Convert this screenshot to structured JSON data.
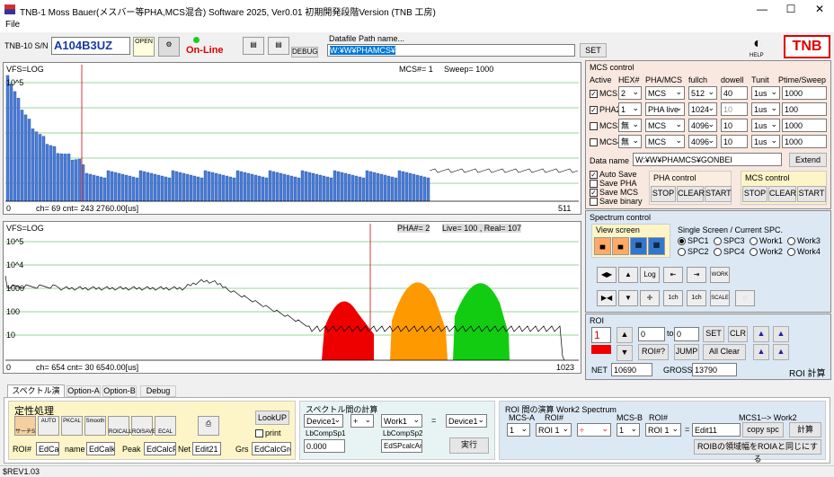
{
  "window": {
    "title": "TNB-1 Moss Bauer(メスバー等PHA,MCS混合) Software 2025,   Ver0.01    初期開発段階Version (TNB  工房)"
  },
  "menu": {
    "file": "File"
  },
  "toolbar": {
    "sn_label": "TNB-10 S/N",
    "sn_value": "A104B3UZ",
    "open_label": "OPEN",
    "online": "On-Line",
    "debug": "DEBUG",
    "datafile_label": "Datafile Path name...",
    "datafile_value": "W:¥W¥PHAMCS¥",
    "set": "SET",
    "help": "HELP",
    "logo": "TNB"
  },
  "top_plot": {
    "scale": "VFS=LOG",
    "decade_label": "10^5",
    "mcs_label": "MCS#= 1",
    "sweep_label": "Sweep=   1000",
    "x_left": "0",
    "x_right": "511",
    "cursor_info": "ch= 69   cnt=    243  2760.00[us]"
  },
  "bottom_plot": {
    "scale": "VFS=LOG",
    "pha_label": "PHA#= 2",
    "live_label": "Live=    100 , Real=    107",
    "y_labels": [
      "10^5",
      "10^4",
      "1000",
      "100",
      "10"
    ],
    "x_left": "0",
    "x_right": "1023",
    "cursor_info": "ch= 654   cnt=    30  6540.00[us]"
  },
  "mcs_control": {
    "title": "MCS control",
    "headers": [
      "Active",
      "HEX#",
      "PHA/MCS",
      "fullch",
      "dowell",
      "Tunit",
      "Ptime/Sweep"
    ],
    "rows": [
      {
        "name": "MCS1",
        "checked": "✓",
        "hex": "2",
        "mode": "MCS",
        "fullch": "512",
        "dowell": "40",
        "tunit": "1us",
        "ptime": "1000"
      },
      {
        "name": "PHA2",
        "checked": "✓",
        "hex": "1",
        "mode": "PHA live",
        "fullch": "1024",
        "dowell": "10",
        "tunit": "1us",
        "ptime": "100"
      },
      {
        "name": "MCS3",
        "checked": "",
        "hex": "無",
        "mode": "MCS",
        "fullch": "4096",
        "dowell": "10",
        "tunit": "1us",
        "ptime": "1000"
      },
      {
        "name": "MCS4",
        "checked": "",
        "hex": "無",
        "mode": "MCS",
        "fullch": "4096",
        "dowell": "10",
        "tunit": "1us",
        "ptime": "1000"
      }
    ],
    "data_name_label": "Data name",
    "data_name_value": "W:¥W¥PHAMCS¥GONBEI",
    "extend": "Extend",
    "auto_save": "Auto Save",
    "save_pha": "Save PHA",
    "save_mcs": "Save MCS",
    "save_binary": "Save binary",
    "pha_control": "PHA control",
    "mcs_control2": "MCS control",
    "stop": "STOP",
    "clear": "CLEAR",
    "start": "START"
  },
  "spectrum_control": {
    "title": "Spectrum control",
    "view_screen": "View screen",
    "single_screen": "Single Screen / Current SPC.",
    "radios": [
      [
        "SPC1",
        "SPC3",
        "Work1",
        "Work3"
      ],
      [
        "SPC2",
        "SPC4",
        "Work2",
        "Work4"
      ]
    ],
    "log": "Log",
    "work": "WORK",
    "ch1": "1ch",
    "ch1b": "1ch",
    "scale": "SCALE"
  },
  "roi": {
    "title": "ROI",
    "number": "1",
    "from": "0",
    "to_label": "to",
    "to": "0",
    "set": "SET",
    "clr": "CLR",
    "roi_q": "ROI#?",
    "jump": "JUMP",
    "all_clear": "All Clear",
    "net_label": "NET",
    "net": "10690",
    "gross_label": "GROSS",
    "gross": "13790",
    "calc": "ROI 計算"
  },
  "tabs": [
    "スペクトル演算",
    "Option-A",
    "Option-B",
    "Debug"
  ],
  "qualitative": {
    "title": "定性処理",
    "icons": [
      "サーチS",
      "AUTO",
      "PKCAL",
      "Smooth",
      "ROICALL",
      "ROISAVE",
      "ECAL"
    ],
    "lookup": "LookUP",
    "print": "print",
    "roi_label": "ROI#",
    "roi_val": "EdCa",
    "name_label": "name",
    "name_val": "EdCalk",
    "peak_label": "Peak",
    "peak_val": "EdCalcF",
    "net_label": "Net",
    "net_val": "Edit21",
    "grs_label": "Grs",
    "grs_val": "EdCalcGro"
  },
  "spec_calc": {
    "title": "スペクトル間の計算",
    "dev1": "Device1",
    "op": "+",
    "work1": "Work1",
    "eq": "=",
    "dev_out": "Device1",
    "lb1": "LbCompSp1",
    "lb2": "LbCompSp2",
    "val": "0.000",
    "arg": "EdSPcalcArg",
    "run": "実行"
  },
  "roi_calc": {
    "title": "ROI 間の演算  Work2 Spectrum",
    "mcsa": "MCS-A",
    "roia": "ROI#",
    "mcsb": "MCS-B",
    "roib": "ROI#",
    "mcs_to_work": "MCS1--> Work2",
    "a_val": "1",
    "roi_a": "ROI 1",
    "op": "÷",
    "b_val": "1",
    "roi_b": "ROI 1",
    "eq": "=",
    "edit": "Edit11",
    "copy": "copy spc",
    "calc": "計算",
    "same": "ROIBの領域幅をROIAと同じにする"
  },
  "status": {
    "text": "$REV1.03"
  }
}
